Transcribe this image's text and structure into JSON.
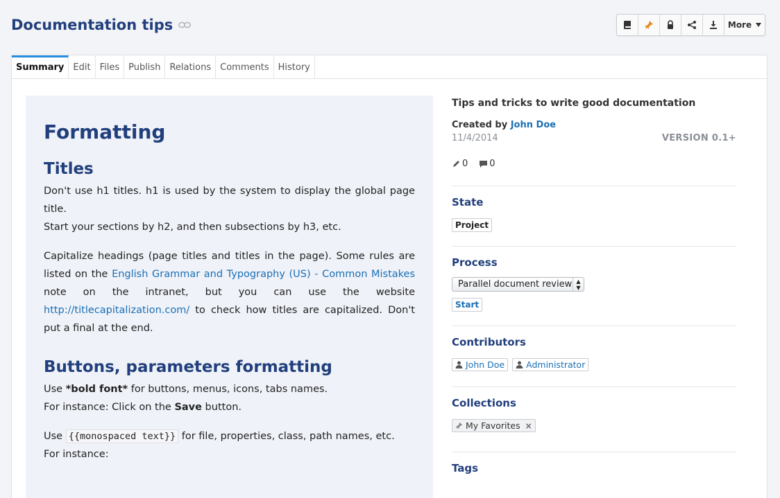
{
  "header": {
    "title": "Documentation tips"
  },
  "toolbar": {
    "more_label": "More"
  },
  "tabs": [
    {
      "label": "Summary"
    },
    {
      "label": "Edit"
    },
    {
      "label": "Files"
    },
    {
      "label": "Publish"
    },
    {
      "label": "Relations"
    },
    {
      "label": "Comments"
    },
    {
      "label": "History"
    }
  ],
  "content": {
    "h1": "Formatting",
    "sec1_title": "Titles",
    "sec1_p1a": "Don't use h1 titles. h1 is used by the system to display the global page title.",
    "sec1_p1b": "Start your sections by h2, and then subsections by h3, etc.",
    "sec1_p2_pre": "Capitalize headings (page titles and titles in the page). Some rules are listed on the ",
    "sec1_p2_link": "English Grammar and Typography (US) - Common Mistakes",
    "sec1_p2_mid": " note on the intranet, but you can use the website ",
    "sec1_p2_url": "http://titlecapitalization.com/",
    "sec1_p2_post": " to check how titles are capitalized. Don't put a final at the end.",
    "sec2_title": "Buttons, parameters formatting",
    "sec2_p1_pre": "Use ",
    "sec2_p1_bold": "*bold font*",
    "sec2_p1_post": " for buttons, menus, icons, tabs names.",
    "sec2_p1b_pre": "For instance: Click on the ",
    "sec2_p1b_bold": "Save",
    "sec2_p1b_post": " button.",
    "sec2_p2_pre": "Use ",
    "sec2_p2_mono": "{{monospaced text}}",
    "sec2_p2_post": " for file, properties, class, path names, etc.",
    "sec2_p2b": "For instance:"
  },
  "side": {
    "description": "Tips and tricks to write good documentation",
    "created_label": "Created by",
    "author": "John Doe",
    "date": "11/4/2014",
    "version": "VERSION 0.1+",
    "edits_count": "0",
    "comments_count": "0",
    "state_title": "State",
    "state_value": "Project",
    "process_title": "Process",
    "process_selected": "Parallel document review",
    "start_label": "Start",
    "contributors_title": "Contributors",
    "contributors": [
      "John Doe",
      "Administrator"
    ],
    "collections_title": "Collections",
    "collection_item": "My Favorites",
    "tags_title": "Tags"
  }
}
